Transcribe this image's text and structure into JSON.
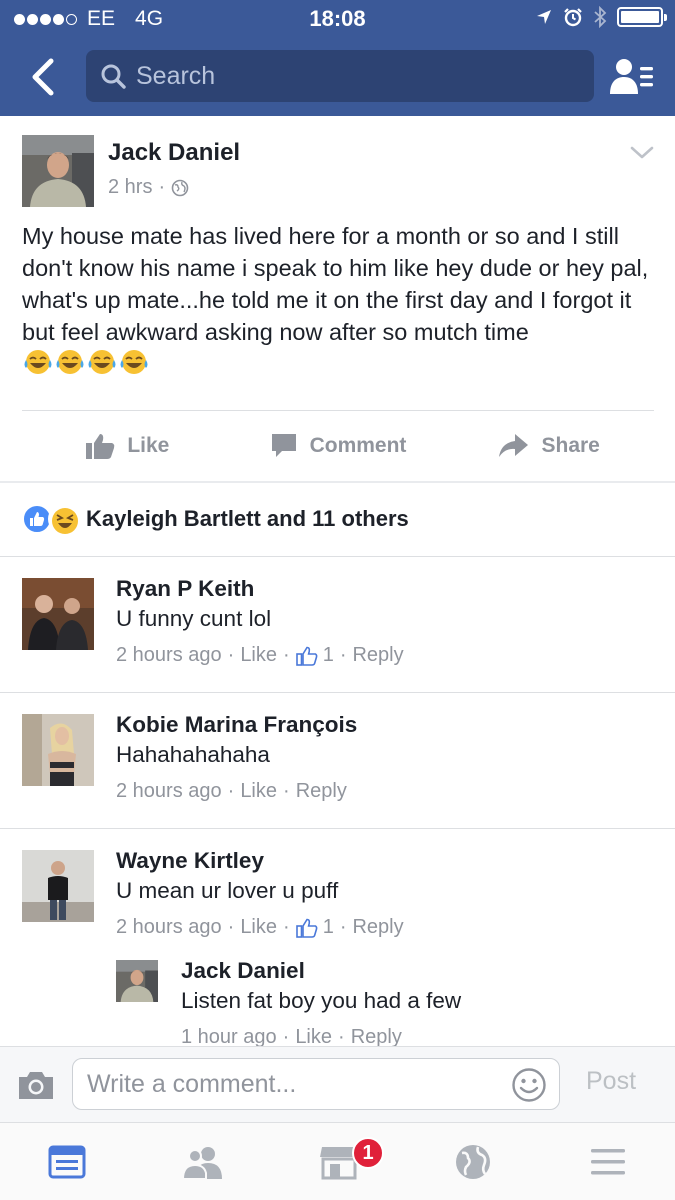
{
  "status_bar": {
    "carrier": "EE",
    "network": "4G",
    "time": "18:08",
    "signal_bars": 4
  },
  "header": {
    "search_placeholder": "Search",
    "icons": [
      "back-chevron-icon",
      "search-icon",
      "friend-requests-icon"
    ]
  },
  "post": {
    "author": "Jack Daniel",
    "time": "2 hrs",
    "audience": "globe-icon",
    "text": "My house mate has lived here for a month or so and I still don't know his name i speak to him like hey dude or hey pal, what's up mate...he told me it on the first day and I forgot it but feel awkward asking now after so mutch time",
    "emoji_count": 4
  },
  "actions": {
    "like": "Like",
    "comment": "Comment",
    "share": "Share"
  },
  "reactions": {
    "text": "Kayleigh Bartlett and 11 others"
  },
  "comments": [
    {
      "name": "Ryan P Keith",
      "text": "U funny cunt lol",
      "time": "2 hours ago",
      "like": "Like",
      "like_count": "1",
      "reply": "Reply"
    },
    {
      "name": "Kobie Marina François",
      "text": "Hahahahahaha",
      "time": "2 hours ago",
      "like": "Like",
      "reply": "Reply"
    },
    {
      "name": "Wayne Kirtley",
      "text": "U mean ur lover u puff",
      "time": "2 hours ago",
      "like": "Like",
      "like_count": "1",
      "reply": "Reply"
    }
  ],
  "reply": {
    "name": "Jack Daniel",
    "text": "Listen fat boy you had a few",
    "time": "1 hour ago",
    "like": "Like",
    "reply": "Reply"
  },
  "composer": {
    "placeholder": "Write a comment...",
    "post_label": "Post"
  },
  "tab_bar": {
    "marketplace_badge": "1",
    "tabs": [
      "news-feed-icon",
      "friends-icon",
      "marketplace-icon",
      "notifications-globe-icon",
      "menu-icon"
    ]
  },
  "colors": {
    "brand": "#3b5998",
    "text": "#1d2129",
    "secondary_text": "#90949c",
    "badge": "#e0213a"
  }
}
